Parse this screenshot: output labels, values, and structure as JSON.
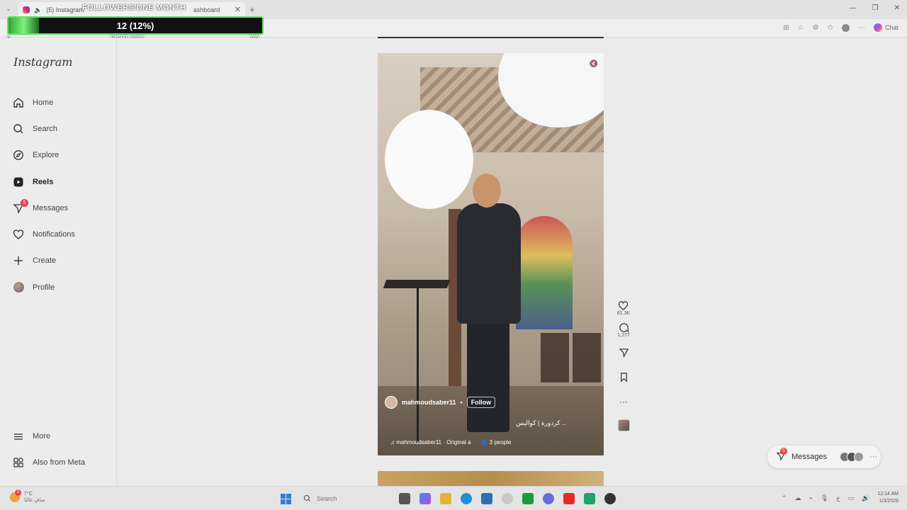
{
  "browser": {
    "tab_title": "(5) Instagram",
    "tab_title_2": "ashboard",
    "chat_label": "Chat"
  },
  "overlay": {
    "title": "FOLLOWERS/ONE MONTH",
    "count_label": "12 (12%)",
    "progress_percent": 12,
    "min_label": "0",
    "mid_label": "RIGHT NOW",
    "max_label": "100"
  },
  "sidebar": {
    "logo": "Instagram",
    "items": [
      {
        "label": "Home",
        "icon": "home-icon"
      },
      {
        "label": "Search",
        "icon": "search-icon"
      },
      {
        "label": "Explore",
        "icon": "compass-icon"
      },
      {
        "label": "Reels",
        "icon": "reels-icon",
        "active": true
      },
      {
        "label": "Messages",
        "icon": "messenger-icon",
        "badge": "5"
      },
      {
        "label": "Notifications",
        "icon": "heart-icon"
      },
      {
        "label": "Create",
        "icon": "plus-icon"
      },
      {
        "label": "Profile",
        "icon": "avatar-icon"
      }
    ],
    "bottom": [
      {
        "label": "More",
        "icon": "menu-icon"
      },
      {
        "label": "Also from Meta",
        "icon": "meta-apps-icon"
      }
    ]
  },
  "reel": {
    "username": "mahmoudsaber11",
    "follow_label": "Follow",
    "caption": "كردورة | كواليس ..",
    "audio": "mahmoudsaber11 · Original a",
    "people": "3 people"
  },
  "actions": {
    "likes": "61.3K",
    "comments": "1,277"
  },
  "messages_pill": {
    "label": "Messages",
    "badge": "5"
  },
  "taskbar": {
    "temp": "7°C",
    "weather_desc": "صافٍ غالبًا",
    "search_placeholder": "Search",
    "time": "12:14 AM",
    "date": "1/3/2026",
    "weather_badge": "5"
  }
}
